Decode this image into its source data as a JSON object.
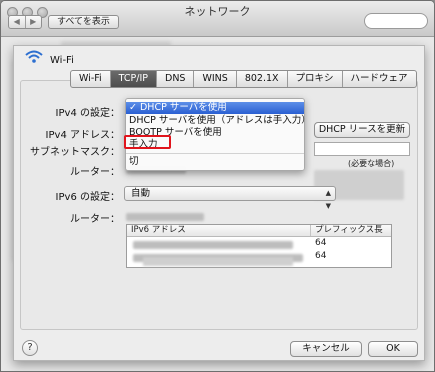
{
  "window": {
    "title": "ネットワーク",
    "show_all_label": "すべてを表示",
    "nav_back": "◀",
    "nav_forward": "▶"
  },
  "sheet": {
    "interface_name": "Wi-Fi",
    "tabs": [
      {
        "label": "Wi-Fi"
      },
      {
        "label": "TCP/IP",
        "active": true
      },
      {
        "label": "DNS"
      },
      {
        "label": "WINS"
      },
      {
        "label": "802.1X"
      },
      {
        "label": "プロキシ"
      },
      {
        "label": "ハードウェア"
      }
    ],
    "ipv4_config_label": "IPv4 の設定：",
    "ipv4_address_label": "IPv4 アドレス：",
    "subnet_mask_label": "サブネットマスク：",
    "router_label": "ルーター：",
    "dhcp_renew_button": "DHCP リースを更新",
    "client_id_note": "(必要な場合)",
    "ipv6_config_label": "IPv6 の設定：",
    "ipv6_config_value": "自動",
    "ipv6_router_label": "ルーター：",
    "ipv6_table": {
      "headers": [
        "IPv6 アドレス",
        "プレフィックス長"
      ],
      "rows": [
        {
          "prefix": "64"
        },
        {
          "prefix": "64"
        }
      ]
    },
    "help_label": "?",
    "cancel_label": "キャンセル",
    "ok_label": "OK"
  },
  "menu": {
    "items": [
      {
        "label": "✓ DHCP サーバを使用",
        "selected": true
      },
      {
        "label": "DHCP サーバを使用（アドレスは手入力）"
      },
      {
        "label": "BOOTP サーバを使用"
      },
      {
        "label": "手入力"
      },
      {
        "label": "切"
      }
    ]
  },
  "colors": {
    "menu_selection": "#2a5fd2",
    "annotation_box": "#e0141c",
    "active_tab": "#4d4d4d"
  }
}
